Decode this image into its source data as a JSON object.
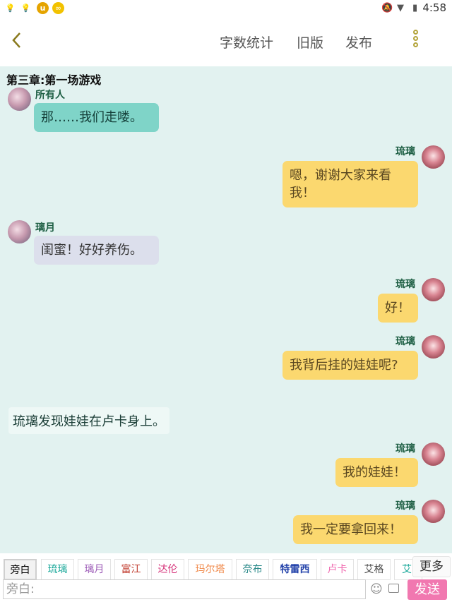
{
  "status": {
    "time": "4:58"
  },
  "topbar": {
    "stats": "字数统计",
    "old_version": "旧版",
    "publish": "发布"
  },
  "chapter_title": "第三章:第一场游戏",
  "messages": [
    {
      "speaker": "所有人",
      "text": "那……我们走喽。"
    },
    {
      "speaker": "琉璃",
      "text": "嗯，谢谢大家来看我！"
    },
    {
      "speaker": "璃月",
      "text": "闺蜜！好好养伤。"
    },
    {
      "speaker": "琉璃",
      "text": "好！"
    },
    {
      "speaker": "琉璃",
      "text": "我背后挂的娃娃呢?"
    },
    {
      "speaker": "",
      "text": "琉璃发现娃娃在卢卡身上。"
    },
    {
      "speaker": "琉璃",
      "text": "我的娃娃！"
    },
    {
      "speaker": "琉璃",
      "text": "我一定要拿回来！"
    }
  ],
  "role_chips": [
    {
      "label": "旁白",
      "color": "#333333"
    },
    {
      "label": "琉璃",
      "color": "#1aa89a"
    },
    {
      "label": "璃月",
      "color": "#9b59b6"
    },
    {
      "label": "富江",
      "color": "#c0392b"
    },
    {
      "label": "达伦",
      "color": "#d6337a"
    },
    {
      "label": "玛尔塔",
      "color": "#f08a4b"
    },
    {
      "label": "奈布",
      "color": "#2b8a8a"
    },
    {
      "label": "特雷西",
      "color": "#1f3fa8"
    },
    {
      "label": "卢卡",
      "color": "#f06ab0"
    },
    {
      "label": "艾格",
      "color": "#4a4a4a"
    },
    {
      "label": "艾",
      "color": "#1aa89a"
    }
  ],
  "more_label": "更多",
  "input": {
    "placeholder": "旁白:"
  },
  "send_label": "发送"
}
